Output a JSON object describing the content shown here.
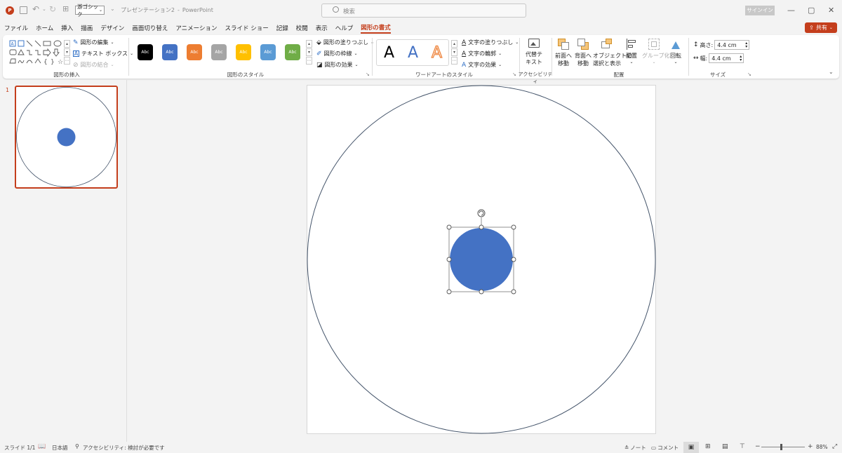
{
  "titlebar": {
    "font_name": "游ゴシック",
    "doc_title": "プレゼンテーション2",
    "separator": "-",
    "app_name": "PowerPoint",
    "search_placeholder": "検索",
    "signin_label": "サインイン",
    "minimize": "—",
    "restore": "▢",
    "close": "✕"
  },
  "tabs": [
    {
      "label": "ファイル"
    },
    {
      "label": "ホーム"
    },
    {
      "label": "挿入"
    },
    {
      "label": "描画"
    },
    {
      "label": "デザイン"
    },
    {
      "label": "画面切り替え"
    },
    {
      "label": "アニメーション"
    },
    {
      "label": "スライド ショー"
    },
    {
      "label": "記録"
    },
    {
      "label": "校閲"
    },
    {
      "label": "表示"
    },
    {
      "label": "ヘルプ"
    },
    {
      "label": "図形の書式",
      "active": true
    }
  ],
  "share_label": "共有",
  "ribbon": {
    "insert_shapes": {
      "edit_shape": "図形の編集",
      "text_box": "テキスト ボックス",
      "merge_shapes": "図形の結合",
      "group_label": "図形の挿入"
    },
    "shape_styles": {
      "swatches": [
        {
          "text": "Abc",
          "color": "#000000"
        },
        {
          "text": "Abc",
          "color": "#4472c4"
        },
        {
          "text": "Abc",
          "color": "#ed7d31"
        },
        {
          "text": "Abc",
          "color": "#a5a5a5"
        },
        {
          "text": "Abc",
          "color": "#ffc000"
        },
        {
          "text": "Abc",
          "color": "#5b9bd5"
        },
        {
          "text": "Abc",
          "color": "#70ad47"
        }
      ],
      "fill": "図形の塗りつぶし",
      "outline": "図形の枠線",
      "effects": "図形の効果",
      "group_label": "図形のスタイル"
    },
    "wordart": {
      "letters": [
        "A",
        "A",
        "A"
      ],
      "text_fill": "文字の塗りつぶし",
      "text_outline": "文字の輪郭",
      "text_effects": "文字の効果",
      "group_label": "ワードアートのスタイル"
    },
    "accessibility": {
      "alt_text_line1": "代替テ",
      "alt_text_line2": "キスト",
      "group_label": "アクセシビリティ"
    },
    "arrange": {
      "bring_forward_1": "前面へ",
      "bring_forward_2": "移動",
      "send_backward_1": "背面へ",
      "send_backward_2": "移動",
      "selection_pane_1": "オブジェクトの",
      "selection_pane_2": "選択と表示",
      "align": "配置",
      "group": "グループ化",
      "rotate": "回転",
      "group_label": "配置"
    },
    "size": {
      "height_label": "高さ:",
      "height_value": "4.4 cm",
      "width_label": "幅:",
      "width_value": "4.4 cm",
      "group_label": "サイズ"
    }
  },
  "thumbnail": {
    "number": "1"
  },
  "slide": {
    "outline_color": "#44546a",
    "fill_color": "#4472c4"
  },
  "status": {
    "slide_label": "スライド 1/1",
    "language": "日本語",
    "accessibility": "アクセシビリティ: 検討が必要です",
    "notes": "ノート",
    "comments": "コメント",
    "zoom_minus": "−",
    "zoom_plus": "+",
    "zoom": "88%"
  }
}
